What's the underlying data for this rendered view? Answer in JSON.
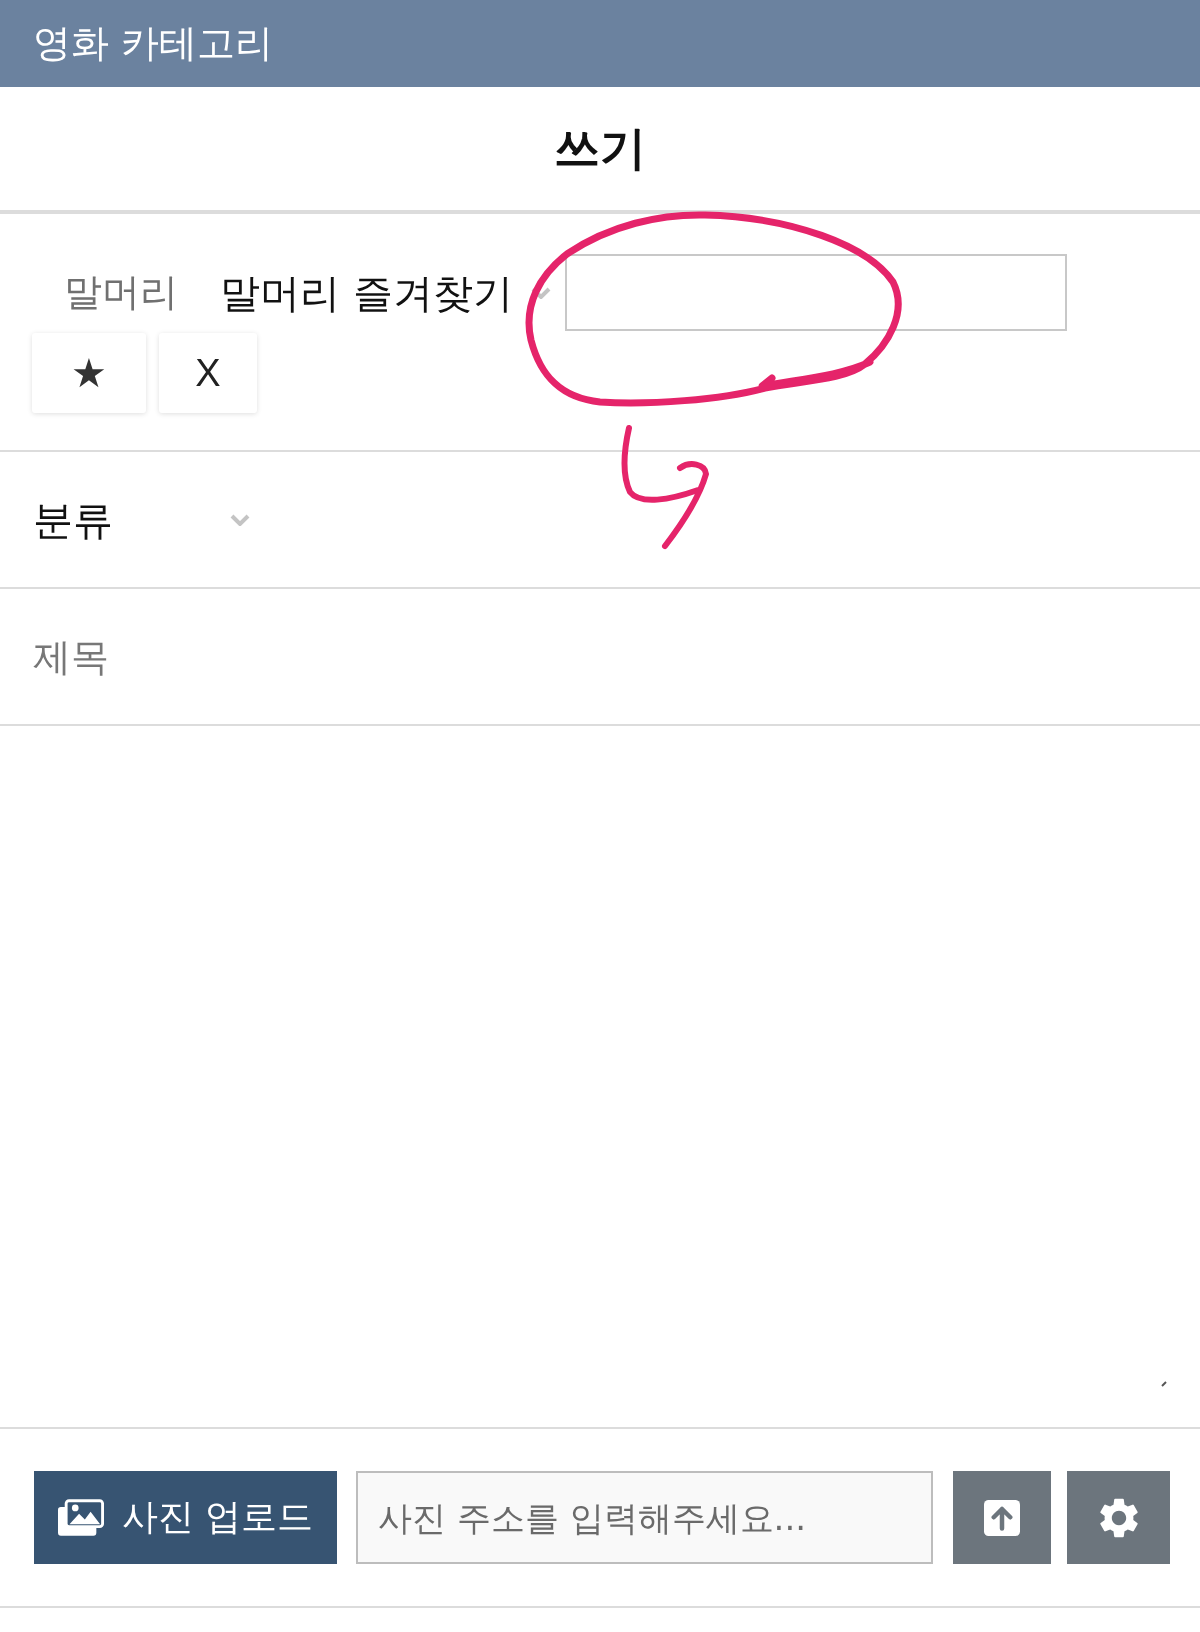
{
  "header": {
    "title": "영화 카테고리"
  },
  "page_title": "쓰기",
  "prefix": {
    "label": "말머리",
    "favorites": "말머리 즐겨찾기",
    "buttons": [
      {
        "kind": "star",
        "label": "★"
      },
      {
        "kind": "clear",
        "label": "X"
      }
    ]
  },
  "category": {
    "value": "분류"
  },
  "title_field": {
    "placeholder": "제목"
  },
  "photo_bar": {
    "upload_label": "사진 업로드",
    "url_placeholder": "사진 주소를 입력해주세요..."
  }
}
